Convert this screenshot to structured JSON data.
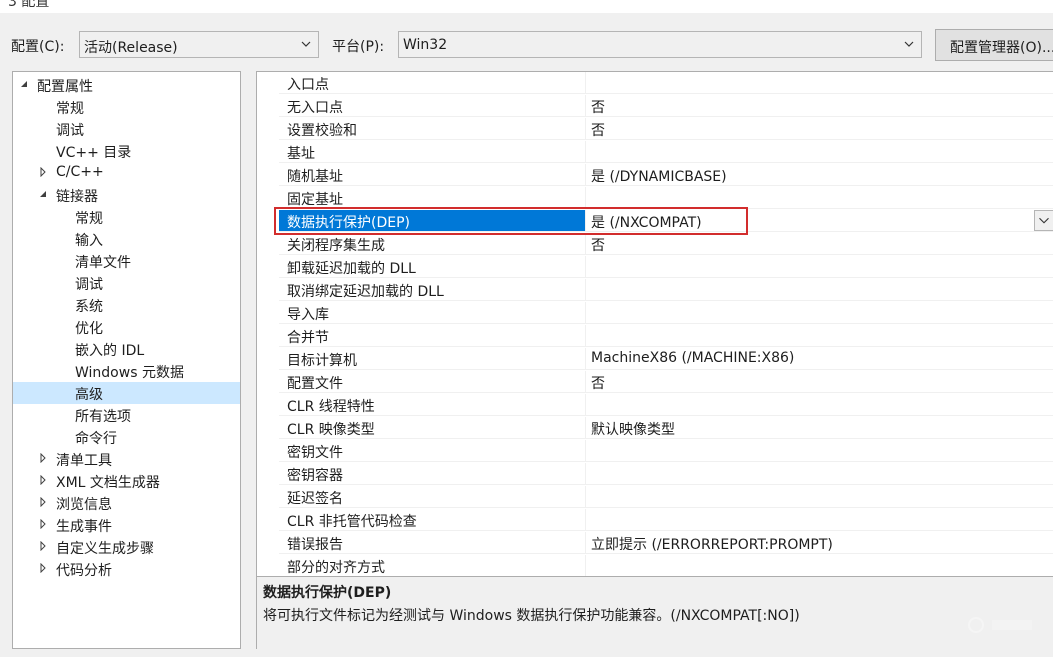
{
  "window": {
    "title_fragment": "3     配置"
  },
  "toolbar": {
    "config_label": "配置(C):",
    "config_value": "活动(Release)",
    "platform_label": "平台(P):",
    "platform_value": "Win32",
    "manager_button": "配置管理器(O)..."
  },
  "tree": {
    "items": [
      {
        "label": "配置属性",
        "expander": "expanded"
      },
      {
        "label": "常规",
        "expander": "none"
      },
      {
        "label": "调试",
        "expander": "none"
      },
      {
        "label": "VC++ 目录",
        "expander": "none"
      },
      {
        "label": "C/C++",
        "expander": "collapsed"
      },
      {
        "label": "链接器",
        "expander": "expanded"
      },
      {
        "label": "常规",
        "expander": "none"
      },
      {
        "label": "输入",
        "expander": "none"
      },
      {
        "label": "清单文件",
        "expander": "none"
      },
      {
        "label": "调试",
        "expander": "none"
      },
      {
        "label": "系统",
        "expander": "none"
      },
      {
        "label": "优化",
        "expander": "none"
      },
      {
        "label": "嵌入的 IDL",
        "expander": "none"
      },
      {
        "label": "Windows 元数据",
        "expander": "none"
      },
      {
        "label": "高级",
        "expander": "none",
        "selected": true
      },
      {
        "label": "所有选项",
        "expander": "none"
      },
      {
        "label": "命令行",
        "expander": "none"
      },
      {
        "label": "清单工具",
        "expander": "collapsed"
      },
      {
        "label": "XML 文档生成器",
        "expander": "collapsed"
      },
      {
        "label": "浏览信息",
        "expander": "collapsed"
      },
      {
        "label": "生成事件",
        "expander": "collapsed"
      },
      {
        "label": "自定义生成步骤",
        "expander": "collapsed"
      },
      {
        "label": "代码分析",
        "expander": "collapsed"
      }
    ]
  },
  "grid": {
    "rows": [
      {
        "name": "入口点",
        "value": ""
      },
      {
        "name": "无入口点",
        "value": "否"
      },
      {
        "name": "设置校验和",
        "value": "否"
      },
      {
        "name": "基址",
        "value": ""
      },
      {
        "name": "随机基址",
        "value": "是 (/DYNAMICBASE)"
      },
      {
        "name": "固定基址",
        "value": ""
      },
      {
        "name": "数据执行保护(DEP)",
        "value": "是 (/NXCOMPAT)",
        "selected": true
      },
      {
        "name": "关闭程序集生成",
        "value": "否"
      },
      {
        "name": "卸载延迟加载的 DLL",
        "value": ""
      },
      {
        "name": "取消绑定延迟加载的 DLL",
        "value": ""
      },
      {
        "name": "导入库",
        "value": ""
      },
      {
        "name": "合并节",
        "value": ""
      },
      {
        "name": "目标计算机",
        "value": "MachineX86 (/MACHINE:X86)"
      },
      {
        "name": "配置文件",
        "value": "否"
      },
      {
        "name": "CLR 线程特性",
        "value": ""
      },
      {
        "name": "CLR 映像类型",
        "value": "默认映像类型"
      },
      {
        "name": "密钥文件",
        "value": ""
      },
      {
        "name": "密钥容器",
        "value": ""
      },
      {
        "name": "延迟签名",
        "value": ""
      },
      {
        "name": "CLR 非托管代码检查",
        "value": ""
      },
      {
        "name": "错误报告",
        "value": "立即提示 (/ERRORREPORT:PROMPT)"
      },
      {
        "name": "部分的对齐方式",
        "value": ""
      }
    ]
  },
  "description": {
    "title": "数据执行保护(DEP)",
    "text": "将可执行文件标记为经测试与 Windows 数据执行保护功能兼容。(/NXCOMPAT[:NO])"
  },
  "colors": {
    "selection": "#0078d7",
    "tree_selection": "#cce8ff",
    "highlight_box": "#d22d2d"
  }
}
